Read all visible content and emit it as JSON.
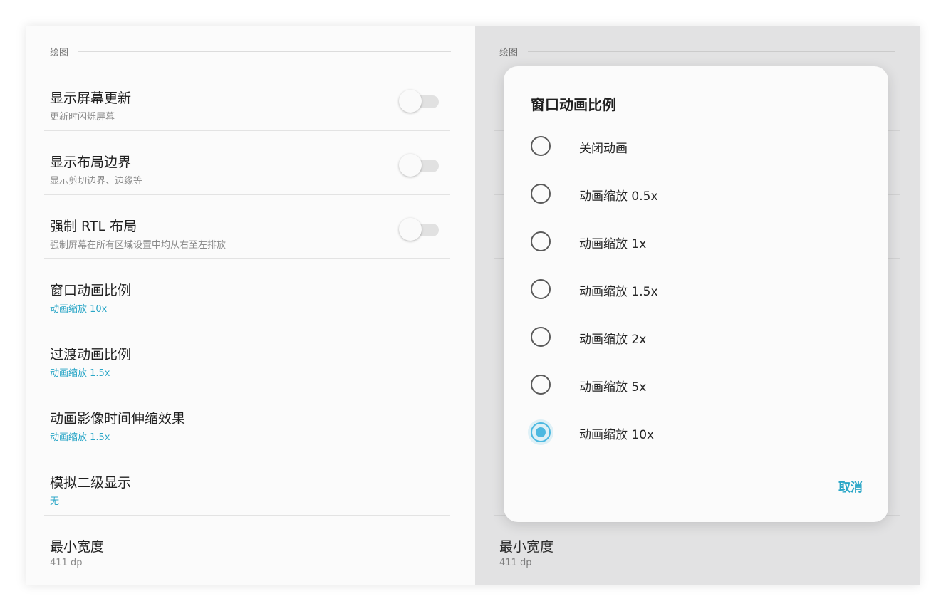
{
  "section_title": "绘图",
  "settings": [
    {
      "title": "显示屏幕更新",
      "summary": "更新时闪烁屏幕",
      "has_switch": true,
      "switch_on": false,
      "accent": false
    },
    {
      "title": "显示布局边界",
      "summary": "显示剪切边界、边缘等",
      "has_switch": true,
      "switch_on": false,
      "accent": false
    },
    {
      "title": "强制 RTL 布局",
      "summary": "强制屏幕在所有区域设置中均从右至左排放",
      "has_switch": true,
      "switch_on": false,
      "accent": false
    },
    {
      "title": "窗口动画比例",
      "summary": "动画缩放 10x",
      "has_switch": false,
      "accent": true
    },
    {
      "title": "过渡动画比例",
      "summary": "动画缩放 1.5x",
      "has_switch": false,
      "accent": true
    },
    {
      "title": "动画影像时间伸缩效果",
      "summary": "动画缩放 1.5x",
      "has_switch": false,
      "accent": true
    },
    {
      "title": "模拟二级显示",
      "summary": "无",
      "has_switch": false,
      "accent": true
    },
    {
      "title": "最小宽度",
      "summary": "411 dp",
      "has_switch": false,
      "accent": false
    }
  ],
  "dialog": {
    "title": "窗口动画比例",
    "options": [
      {
        "label": "关闭动画",
        "selected": false
      },
      {
        "label": "动画缩放 0.5x",
        "selected": false
      },
      {
        "label": "动画缩放 1x",
        "selected": false
      },
      {
        "label": "动画缩放 1.5x",
        "selected": false
      },
      {
        "label": "动画缩放 2x",
        "selected": false
      },
      {
        "label": "动画缩放 5x",
        "selected": false
      },
      {
        "label": "动画缩放 10x",
        "selected": true
      }
    ],
    "cancel_label": "取消"
  },
  "colors": {
    "accent": "#2aa6c7",
    "radio_checked": "#4cb8e0",
    "scrim_background": "#e2e2e3",
    "panel_background": "#fbfbfb"
  }
}
